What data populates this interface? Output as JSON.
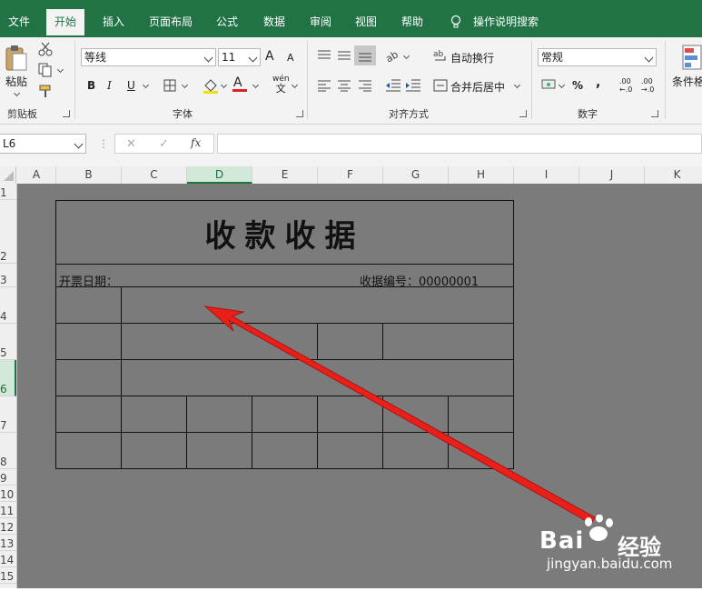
{
  "tabs": [
    "文件",
    "开始",
    "插入",
    "页面布局",
    "公式",
    "数据",
    "审阅",
    "视图",
    "帮助",
    "操作说明搜索"
  ],
  "active_tab": "开始",
  "ribbon": {
    "clipboard": {
      "paste_label": "粘贴",
      "group_label": "剪贴板"
    },
    "font": {
      "font_name": "等线",
      "font_size": "11",
      "bold": "B",
      "italic": "I",
      "underline": "U",
      "font_color_glyph": "A",
      "phonetic_top": "wén",
      "phonetic_bottom": "文",
      "grow": "A",
      "shrink": "A",
      "group_label": "字体"
    },
    "alignment": {
      "wrap_text": "自动换行",
      "merge_center": "合并后居中",
      "group_label": "对齐方式"
    },
    "number": {
      "format": "常规",
      "percent": "%",
      "comma": ",",
      "inc_decimal_top": ".00",
      "inc_decimal_bottom": "←.0",
      "dec_decimal_top": ".00",
      "dec_decimal_bottom": "→.0",
      "group_label": "数字"
    },
    "styles": {
      "conditional_label": "条件格"
    }
  },
  "formula_bar": {
    "name_box": "L6",
    "fx": "fx",
    "formula": ""
  },
  "columns": [
    "A",
    "B",
    "C",
    "D",
    "E",
    "F",
    "G",
    "H",
    "I",
    "J",
    "K"
  ],
  "selected_column": "D",
  "rows": [
    "1",
    "2",
    "3",
    "4",
    "5",
    "6",
    "7",
    "8",
    "9",
    "10",
    "11",
    "12",
    "13",
    "14",
    "15"
  ],
  "selected_row": "6",
  "receipt": {
    "title": "收款收据",
    "issue_date_label": "开票日期：",
    "receipt_no_label": "收据编号：00000001"
  },
  "watermark": {
    "brand": "Bai",
    "brand2": "经验",
    "url": "jingyan.baidu.com"
  },
  "colors": {
    "accent": "#217346",
    "sheet_bg": "#7b7b7b",
    "arrow": "#e8201a"
  }
}
